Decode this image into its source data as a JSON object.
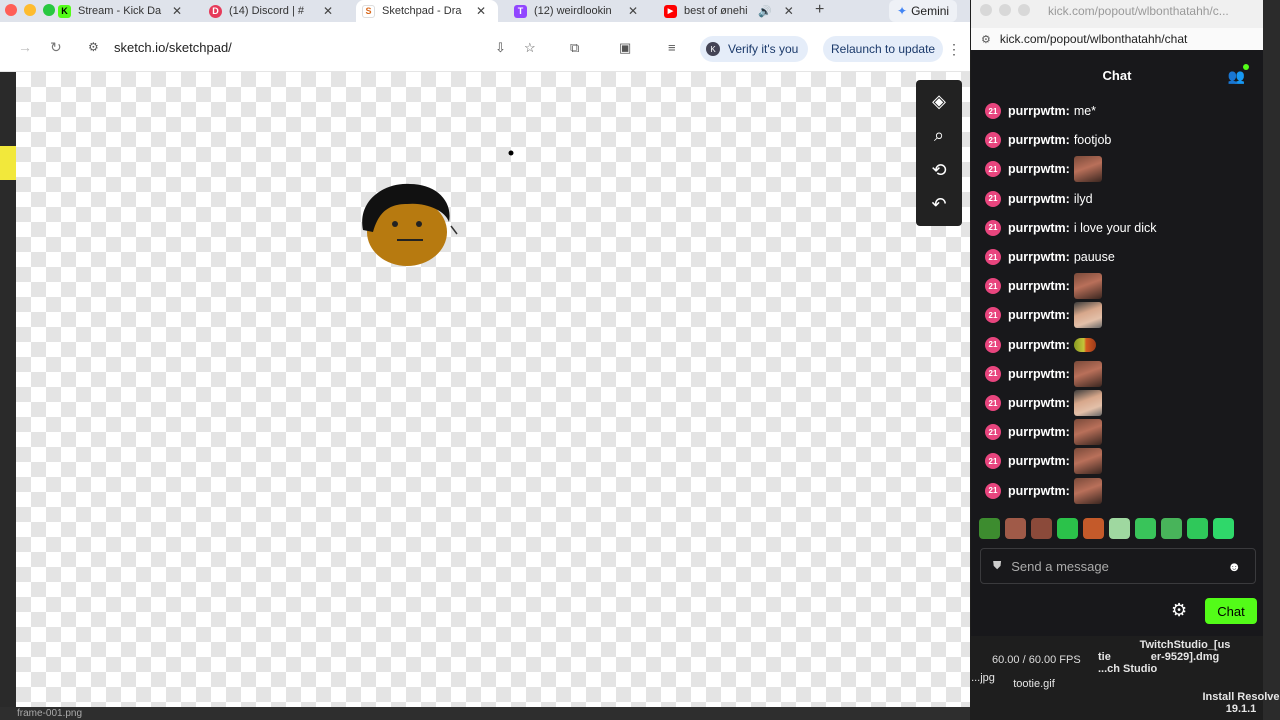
{
  "browser": {
    "tabs": [
      {
        "title": "Stream - Kick Da",
        "color": "#53fc18",
        "glyph": "K"
      },
      {
        "title": "(14) Discord | #",
        "color": "#e63a5a",
        "glyph": "D"
      },
      {
        "title": "Sketchpad - Dra",
        "color": "#ffffff",
        "glyph": "S"
      },
      {
        "title": "(12) weirdlookin",
        "color": "#9146ff",
        "glyph": "T"
      },
      {
        "title": "best of ønehi",
        "color": "#ff0000",
        "glyph": "▶"
      }
    ],
    "gemini_label": "Gemini",
    "url": "sketch.io/sketchpad/",
    "verify_label": "Verify it's you",
    "relaunch_label": "Relaunch to update",
    "status_text": "frame-001.png"
  },
  "chatwin": {
    "title": "kick.com/popout/wlbonthatahh/c...",
    "url": "kick.com/popout/wlbonthatahh/chat",
    "header": "Chat",
    "badge_text": "21",
    "messages": [
      {
        "user": "purrpwtm:",
        "text": "me*",
        "emote": ""
      },
      {
        "user": "purrpwtm:",
        "text": "footjob",
        "emote": ""
      },
      {
        "user": "purrpwtm:",
        "text": "",
        "emote": "face"
      },
      {
        "user": "purrpwtm:",
        "text": "ilyd",
        "emote": ""
      },
      {
        "user": "purrpwtm:",
        "text": "i love your dick",
        "emote": ""
      },
      {
        "user": "purrpwtm:",
        "text": "pauuse",
        "emote": ""
      },
      {
        "user": "purrpwtm:",
        "text": "",
        "emote": "face"
      },
      {
        "user": "purrpwtm:",
        "text": "",
        "emote": "face2"
      },
      {
        "user": "purrpwtm:",
        "text": "",
        "emote": "small"
      },
      {
        "user": "purrpwtm:",
        "text": "",
        "emote": "face"
      },
      {
        "user": "purrpwtm:",
        "text": "",
        "emote": "face2"
      },
      {
        "user": "purrpwtm:",
        "text": "",
        "emote": "face"
      },
      {
        "user": "purrpwtm:",
        "text": "",
        "emote": "face"
      },
      {
        "user": "purrpwtm:",
        "text": "",
        "emote": "face"
      }
    ],
    "emote_bar_colors": [
      "#3d8c2f",
      "#a05a48",
      "#8b4a3a",
      "#2bc24a",
      "#c45a2a",
      "#9fd8a0",
      "#39c45a",
      "#48b45a",
      "#2fc85a",
      "#2fd86a"
    ],
    "input_placeholder": "Send a message",
    "chat_button": "Chat"
  },
  "desktop": {
    "fps": "60.00 / 60.00 FPS",
    "file_tootie": "tootie.gif",
    "twitch_studio": "TwitchStudio_[us\ner-9529].dmg",
    "twitch_studio_app": "tie\n...ch Studio",
    "resolve": "Install Resolve\n19.1.1",
    "jpg": "...jpg"
  }
}
